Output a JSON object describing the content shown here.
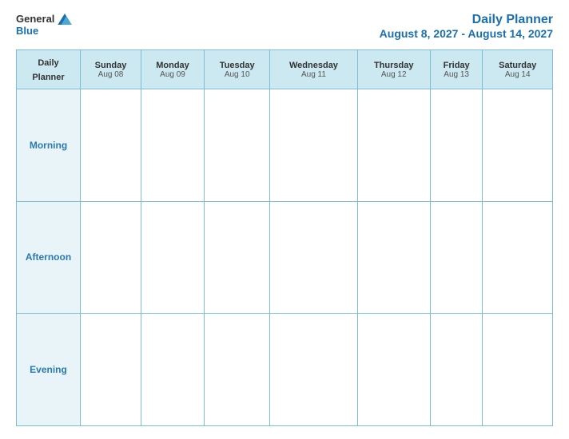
{
  "header": {
    "logo": {
      "general": "General",
      "blue": "Blue",
      "icon_label": "general-blue-logo"
    },
    "title": "Daily Planner",
    "date_range": "August 8, 2027 - August 14, 2027"
  },
  "table": {
    "label_header": {
      "line1": "Daily",
      "line2": "Planner"
    },
    "columns": [
      {
        "day": "Sunday",
        "date": "Aug 08"
      },
      {
        "day": "Monday",
        "date": "Aug 09"
      },
      {
        "day": "Tuesday",
        "date": "Aug 10"
      },
      {
        "day": "Wednesday",
        "date": "Aug 11"
      },
      {
        "day": "Thursday",
        "date": "Aug 12"
      },
      {
        "day": "Friday",
        "date": "Aug 13"
      },
      {
        "day": "Saturday",
        "date": "Aug 14"
      }
    ],
    "rows": [
      {
        "label": "Morning"
      },
      {
        "label": "Afternoon"
      },
      {
        "label": "Evening"
      }
    ]
  }
}
